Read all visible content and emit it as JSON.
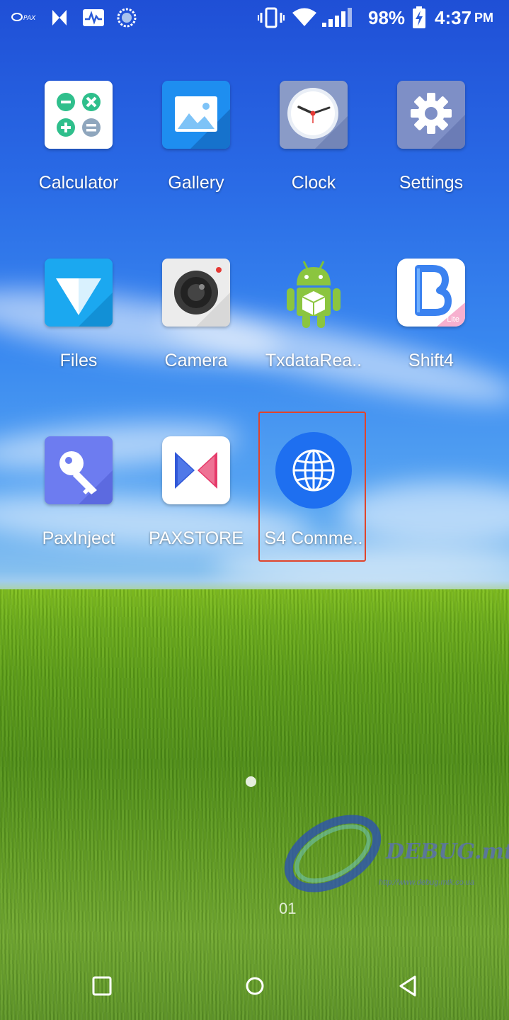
{
  "status_bar": {
    "battery": "98%",
    "time": "4:37",
    "ampm": "PM"
  },
  "apps": [
    {
      "label": "Calculator",
      "icon": "calculator-icon"
    },
    {
      "label": "Gallery",
      "icon": "gallery-icon"
    },
    {
      "label": "Clock",
      "icon": "clock-icon"
    },
    {
      "label": "Settings",
      "icon": "gear-icon"
    },
    {
      "label": "Files",
      "icon": "files-icon"
    },
    {
      "label": "Camera",
      "icon": "camera-icon"
    },
    {
      "label": "TxdataRea..",
      "icon": "android-icon"
    },
    {
      "label": "Shift4",
      "icon": "shift4-icon"
    },
    {
      "label": "PaxInject",
      "icon": "key-icon"
    },
    {
      "label": "PAXSTORE",
      "icon": "paxstore-icon"
    },
    {
      "label": "S4 Comme..",
      "icon": "globe-icon"
    }
  ],
  "shift4_badge": "Lite",
  "watermark": {
    "title": "DEBUG.mtk",
    "sub": "http://www.debug.mtk.co.ua"
  },
  "page_indicator": "01",
  "colors": {
    "highlight": "#e0442b",
    "globe_blue": "#1e6ff0"
  }
}
